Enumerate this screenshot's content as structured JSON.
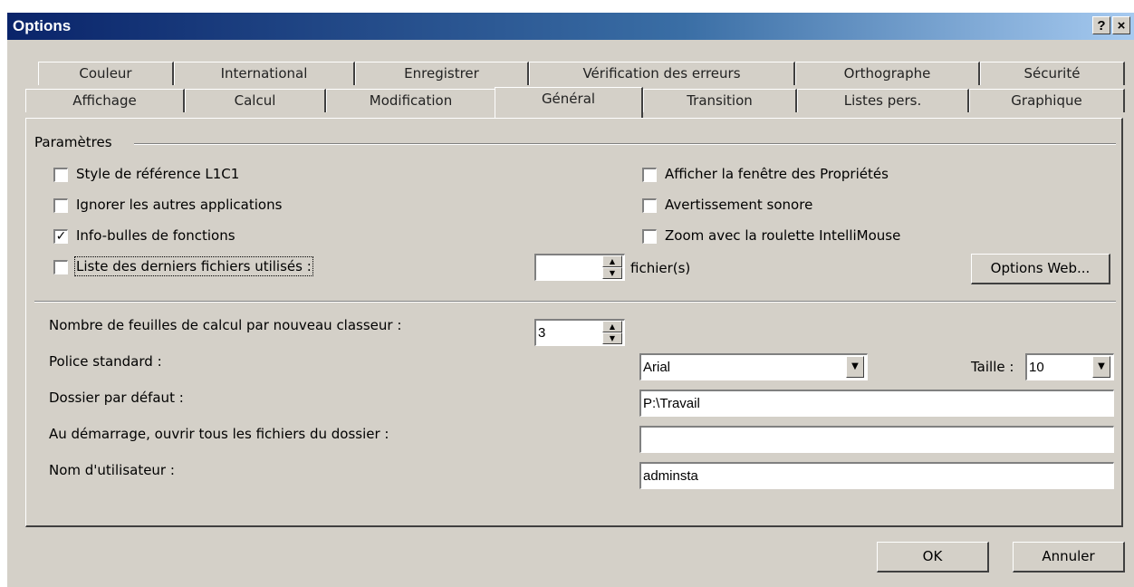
{
  "window": {
    "title": "Options",
    "help_button": "?",
    "close_button": "×"
  },
  "tabs_row1": [
    "Couleur",
    "International",
    "Enregistrer",
    "Vérification des erreurs",
    "Orthographe",
    "Sécurité"
  ],
  "tabs_row2": [
    "Affichage",
    "Calcul",
    "Modification",
    "Général",
    "Transition",
    "Listes pers.",
    "Graphique"
  ],
  "active_tab": "Général",
  "parametres": {
    "group_title": "Paramètres",
    "checkboxes_left": [
      {
        "label": "Style de référence L1C1",
        "checked": false
      },
      {
        "label": "Ignorer les autres applications",
        "checked": false
      },
      {
        "label": "Info-bulles de fonctions",
        "checked": true
      },
      {
        "label": "Liste des derniers fichiers utilisés :",
        "checked": false
      }
    ],
    "checkboxes_right": [
      {
        "label": "Afficher la fenêtre des Propriétés",
        "checked": false
      },
      {
        "label": "Avertissement sonore",
        "checked": false
      },
      {
        "label": "Zoom avec la roulette IntelliMouse",
        "checked": false
      }
    ],
    "recent_files_value": "",
    "recent_files_unit": "fichier(s)",
    "options_web_button": "Options Web..."
  },
  "settings": {
    "sheets_label": "Nombre de feuilles de calcul par nouveau classeur :",
    "sheets_value": "3",
    "font_label": "Police standard :",
    "font_value": "Arial",
    "size_label": "Taille :",
    "size_value": "10",
    "folder_label": "Dossier par défaut :",
    "folder_value": "P:\\Travail",
    "startup_label": "Au démarrage, ouvrir tous les fichiers du dossier :",
    "startup_value": "",
    "user_label": "Nom d'utilisateur :",
    "user_value": "adminsta"
  },
  "footer": {
    "ok_button": "OK",
    "cancel_button": "Annuler"
  }
}
